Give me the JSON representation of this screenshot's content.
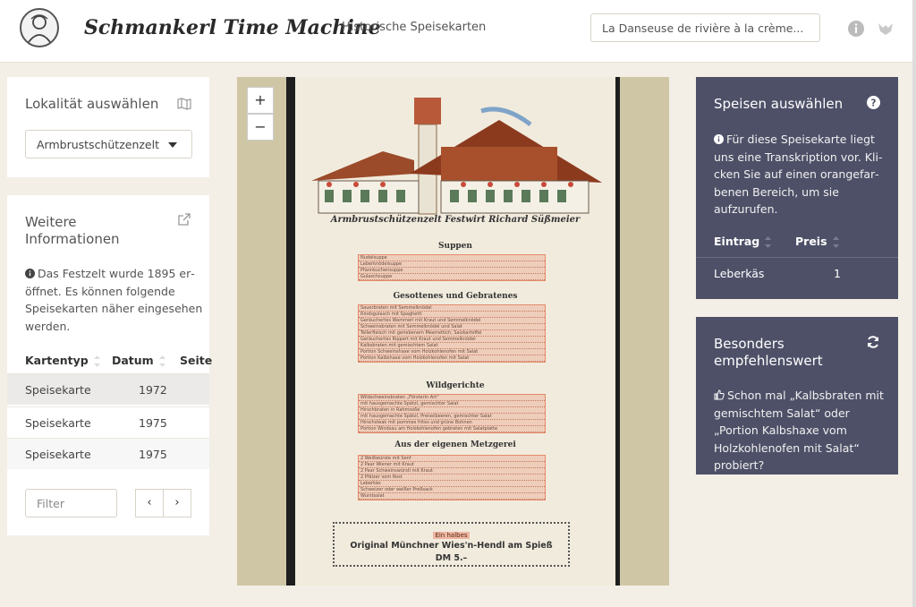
{
  "header": {
    "title": "Schmankerl Time Machine",
    "nav_label": "Historische Speisekarten",
    "search_value": "La Danseuse de rivière à la crème..."
  },
  "locality": {
    "title": "Lokalität auswählen",
    "selected": "Armbrustschützenzelt"
  },
  "more_info": {
    "title": "Weitere Informationen",
    "text": "Das Festzelt wurde 1895 er­öffnet. Es können folgende Speisekarten näher eingese­hen werden.",
    "columns": [
      "Kartentyp",
      "Datum",
      "Seite"
    ],
    "rows": [
      {
        "type": "Speisekarte",
        "date": "1972"
      },
      {
        "type": "Speisekarte",
        "date": "1975"
      },
      {
        "type": "Speisekarte",
        "date": "1975"
      }
    ],
    "filter_placeholder": "Filter",
    "prev": "‹",
    "next": "›"
  },
  "viewer": {
    "zoom_in": "+",
    "zoom_out": "−",
    "menu": {
      "banner": "Armbrustschützenzelt Festwirt Richard Süßmeier",
      "sections": [
        {
          "heading": "Suppen",
          "items": [
            "Nudelsuppe",
            "Leberknödelsuppe",
            "Pfannkuchensuppe",
            "Gulaschsuppe"
          ]
        },
        {
          "heading": "Gesottenes und Gebratenes",
          "items": [
            "Sauerbraten mit Semmelknödel",
            "Rindsgulasch mit Spaghetti",
            "Geräuchertes Wammerl mit Kraut und Semmelknödel",
            "Schweinsbraten mit Semmelknödel und Salat",
            "Tellerfleisch mit geriebenem Meerrettich, Salzkartoffel",
            "Geräuchertes Rippert mit Kraut und Semmelknödel",
            "Kalbsbraten mit gemischtem Salat",
            "Portion Schweinshaxe vom Holzkohlenofen mit Salat",
            "Portion Kalbshaxe vom Holzkohlenofen mit Salat"
          ]
        },
        {
          "heading": "Wildgerichte",
          "items": [
            "Wildschweinsbraten „Försterin Art“",
            "mit hausgemachte Spätzl, gemischter Salat",
            "Hirschbraten in Rahmsoße",
            "mit hausgemachte Spätzl, Preiselbeeren, gemischter Salat",
            "Hirschsteak mit pommes frites und grüne Bohnen",
            "Portion Windsau am Holzkohlenofen gebraten mit Salatplatte"
          ]
        },
        {
          "heading": "Aus der eigenen Metzgerei",
          "items": [
            "2 Weißwürste mit Senf",
            "2 Paar Wiener mit Kraut",
            "2 Paar Schweinswürstl mit Kraut",
            "2 Pfälzer vom Rost",
            "Leberkäs",
            "Schweizer oder weißer Preßsack",
            "Wurstsalat"
          ]
        }
      ],
      "note_small": "Ein halbes",
      "note_main": "Original Münchner Wies'n-Hendl am Spieß",
      "note_price": "DM 5.–"
    }
  },
  "dishes": {
    "title": "Speisen auswählen",
    "text": "Für diese Speisekarte liegt uns eine Transkription vor. Kli­cken Sie auf einen orangefar­benen Bereich, um sie aufzuru­fen.",
    "columns": [
      "Eintrag",
      "Preis"
    ],
    "row": {
      "entry": "Leberkäs",
      "price": "1"
    }
  },
  "recommend": {
    "title": "Besonders empfehlenswert",
    "text": "Schon mal „Kalbsbraten mit gemischtem Salat“ oder „Porti­on Kalbshaxe vom Holzkohlen­ofen mit Salat“ probiert?"
  },
  "colors": {
    "accent_dark": "#4e5068",
    "highlight": "#e48a6a",
    "background": "#f3efe6"
  }
}
